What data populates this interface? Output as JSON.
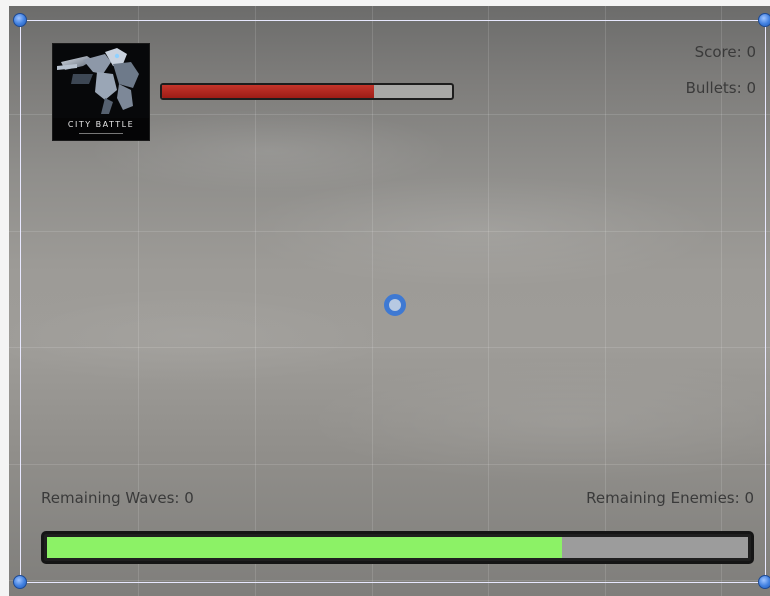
{
  "logo": {
    "title": "CITY BATTLE"
  },
  "hud": {
    "score_label": "Score: 0",
    "bullets_label": "Bullets: 0",
    "remaining_waves_label": "Remaining Waves: 0",
    "remaining_enemies_label": "Remaining Enemies: 0"
  },
  "player_health": {
    "fraction": 0.73,
    "color": "#b52a22"
  },
  "wave_progress": {
    "fraction": 0.735,
    "color": "#8cf266"
  },
  "crosshair": {
    "icon": "crosshair-ring-icon",
    "color": "#3e79d3"
  },
  "selection_handles": {
    "icon": "selection-handle-icon",
    "color": "#3f7fe0"
  }
}
